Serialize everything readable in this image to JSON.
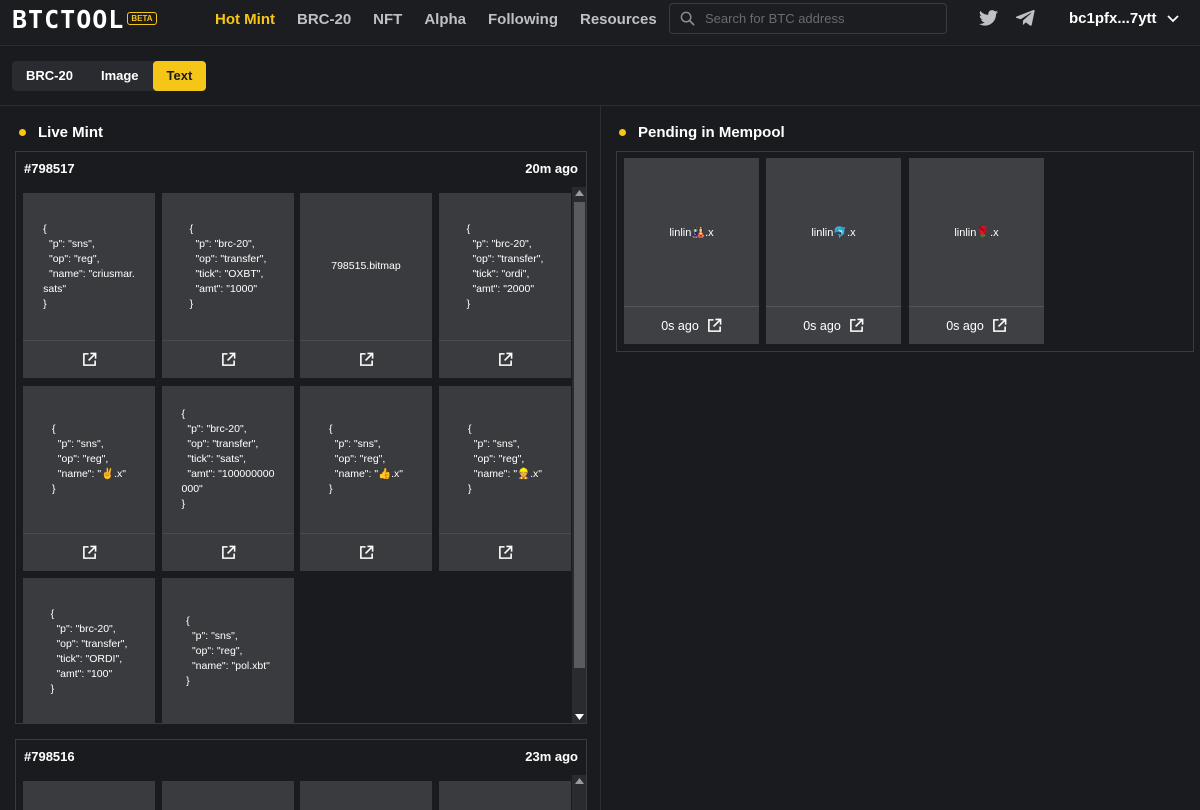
{
  "header": {
    "logo": "BTCTOOL",
    "badge": "BETA",
    "nav": [
      "Hot Mint",
      "BRC-20",
      "NFT",
      "Alpha",
      "Following",
      "Resources"
    ],
    "search_placeholder": "Search for BTC address",
    "wallet": "bc1pfx...7ytt"
  },
  "tabs": [
    "BRC-20",
    "Image",
    "Text"
  ],
  "live_mint": {
    "title": "Live Mint",
    "blocks": [
      {
        "number": "#798517",
        "time": "20m ago",
        "cards": [
          "{\n  \"p\": \"sns\",\n  \"op\": \"reg\",\n  \"name\": \"criusmar.\nsats\"\n}",
          "{\n  \"p\": \"brc-20\",\n  \"op\": \"transfer\",\n  \"tick\": \"OXBT\",\n  \"amt\": \"1000\"\n}",
          "798515.bitmap",
          "{\n  \"p\": \"brc-20\",\n  \"op\": \"transfer\",\n  \"tick\": \"ordi\",\n  \"amt\": \"2000\"\n}",
          "{\n  \"p\": \"sns\",\n  \"op\": \"reg\",\n  \"name\": \"✌️.x\"\n}",
          "{\n  \"p\": \"brc-20\",\n  \"op\": \"transfer\",\n  \"tick\": \"sats\",\n  \"amt\": \"100000000\n000\"\n}",
          "{\n  \"p\": \"sns\",\n  \"op\": \"reg\",\n  \"name\": \"👍.x\"\n}",
          "{\n  \"p\": \"sns\",\n  \"op\": \"reg\",\n  \"name\": \"👷.x\"\n}",
          "{\n  \"p\": \"brc-20\",\n  \"op\": \"transfer\",\n  \"tick\": \"ORDI\",\n  \"amt\": \"100\"\n}",
          "{\n  \"p\": \"sns\",\n  \"op\": \"reg\",\n  \"name\": \"pol.xbt\"\n}"
        ]
      },
      {
        "number": "#798516",
        "time": "23m ago"
      }
    ]
  },
  "mempool": {
    "title": "Pending in Mempool",
    "cards": [
      {
        "name": "linlin🎎.x",
        "time": "0s ago"
      },
      {
        "name": "linlin🐬.x",
        "time": "0s ago"
      },
      {
        "name": "linlin🌹.x",
        "time": "0s ago"
      }
    ]
  },
  "colors": {
    "accent": "#f5c518",
    "background": "#1a1b1f",
    "card": "#3a3b3f"
  }
}
